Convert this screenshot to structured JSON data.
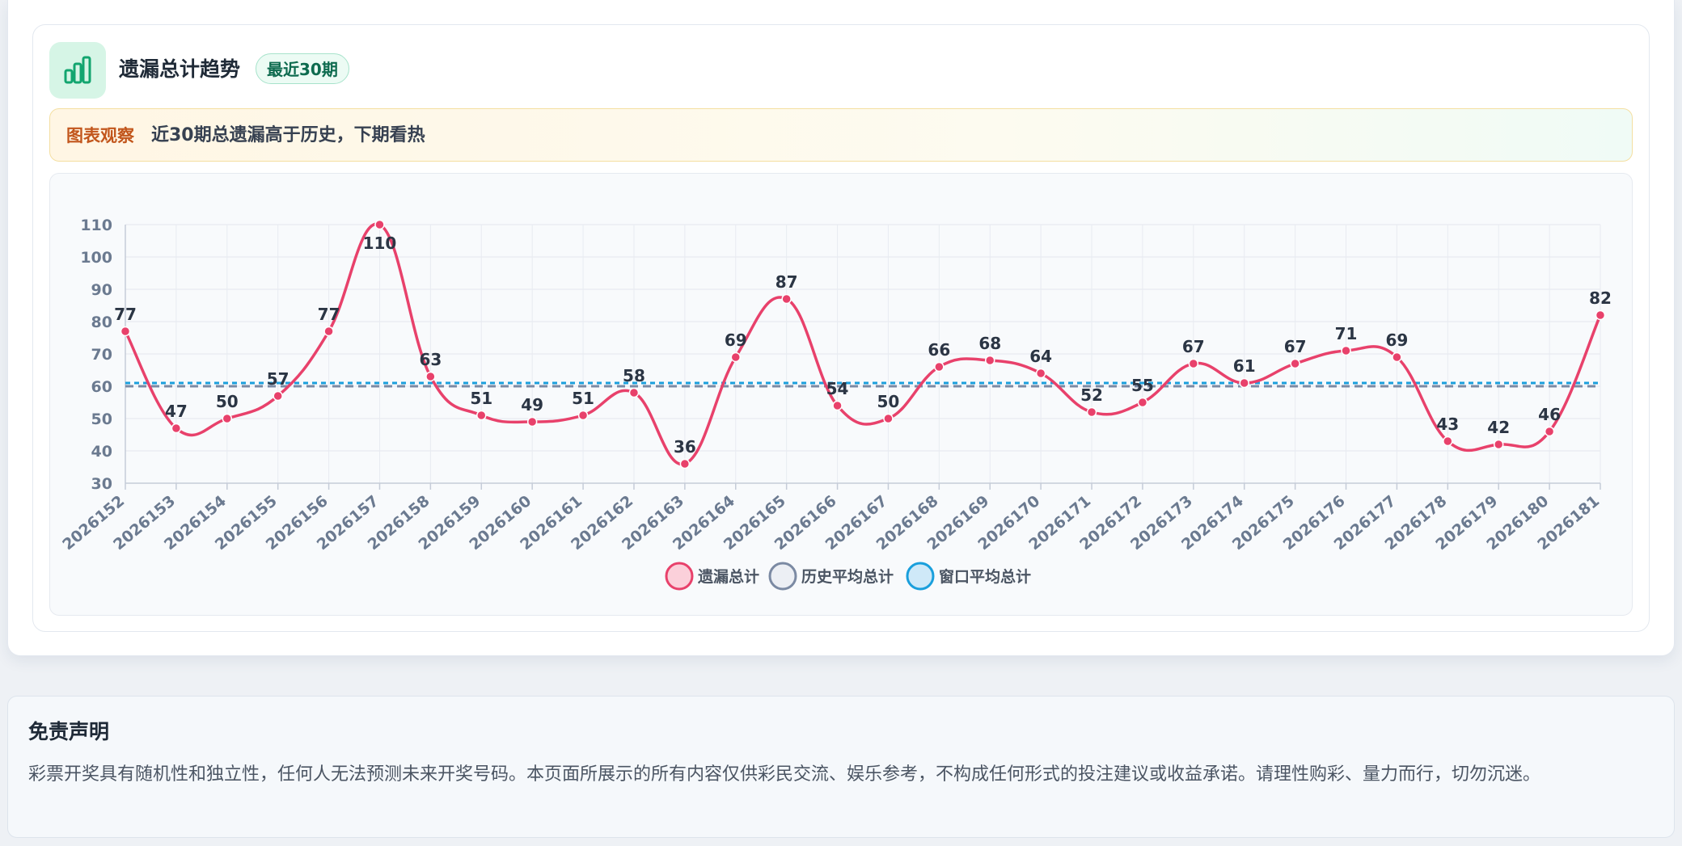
{
  "header": {
    "title": "遗漏总计趋势",
    "badge": "最近30期"
  },
  "observation": {
    "label": "图表观察",
    "text": "近30期总遗漏高于历史，下期看热"
  },
  "colors": {
    "series_main": "#e8416b",
    "series_history": "#7b8aa3",
    "series_window": "#1a9fdc"
  },
  "chart_data": {
    "type": "line",
    "categories": [
      "2026152",
      "2026153",
      "2026154",
      "2026155",
      "2026156",
      "2026157",
      "2026158",
      "2026159",
      "2026160",
      "2026161",
      "2026162",
      "2026163",
      "2026164",
      "2026165",
      "2026166",
      "2026167",
      "2026168",
      "2026169",
      "2026170",
      "2026171",
      "2026172",
      "2026173",
      "2026174",
      "2026175",
      "2026176",
      "2026177",
      "2026178",
      "2026179",
      "2026180",
      "2026181"
    ],
    "series": [
      {
        "name": "遗漏总计",
        "style": "line-with-labels",
        "values": [
          77,
          47,
          50,
          57,
          77,
          110,
          63,
          51,
          49,
          51,
          58,
          36,
          69,
          87,
          54,
          50,
          66,
          68,
          64,
          52,
          55,
          67,
          61,
          67,
          71,
          69,
          43,
          42,
          46,
          82
        ]
      },
      {
        "name": "历史平均总计",
        "style": "dashed-constant",
        "value": 60
      },
      {
        "name": "窗口平均总计",
        "style": "dashed-constant",
        "value": 61
      }
    ],
    "ylim": [
      30,
      110
    ],
    "yticks": [
      30,
      40,
      50,
      60,
      70,
      80,
      90,
      100,
      110
    ],
    "grid": true,
    "legend_position": "bottom-center"
  },
  "disclaimer": {
    "title": "免责声明",
    "text": "彩票开奖具有随机性和独立性，任何人无法预测未来开奖号码。本页面所展示的所有内容仅供彩民交流、娱乐参考，不构成任何形式的投注建议或收益承诺。请理性购彩、量力而行，切勿沉迷。"
  }
}
